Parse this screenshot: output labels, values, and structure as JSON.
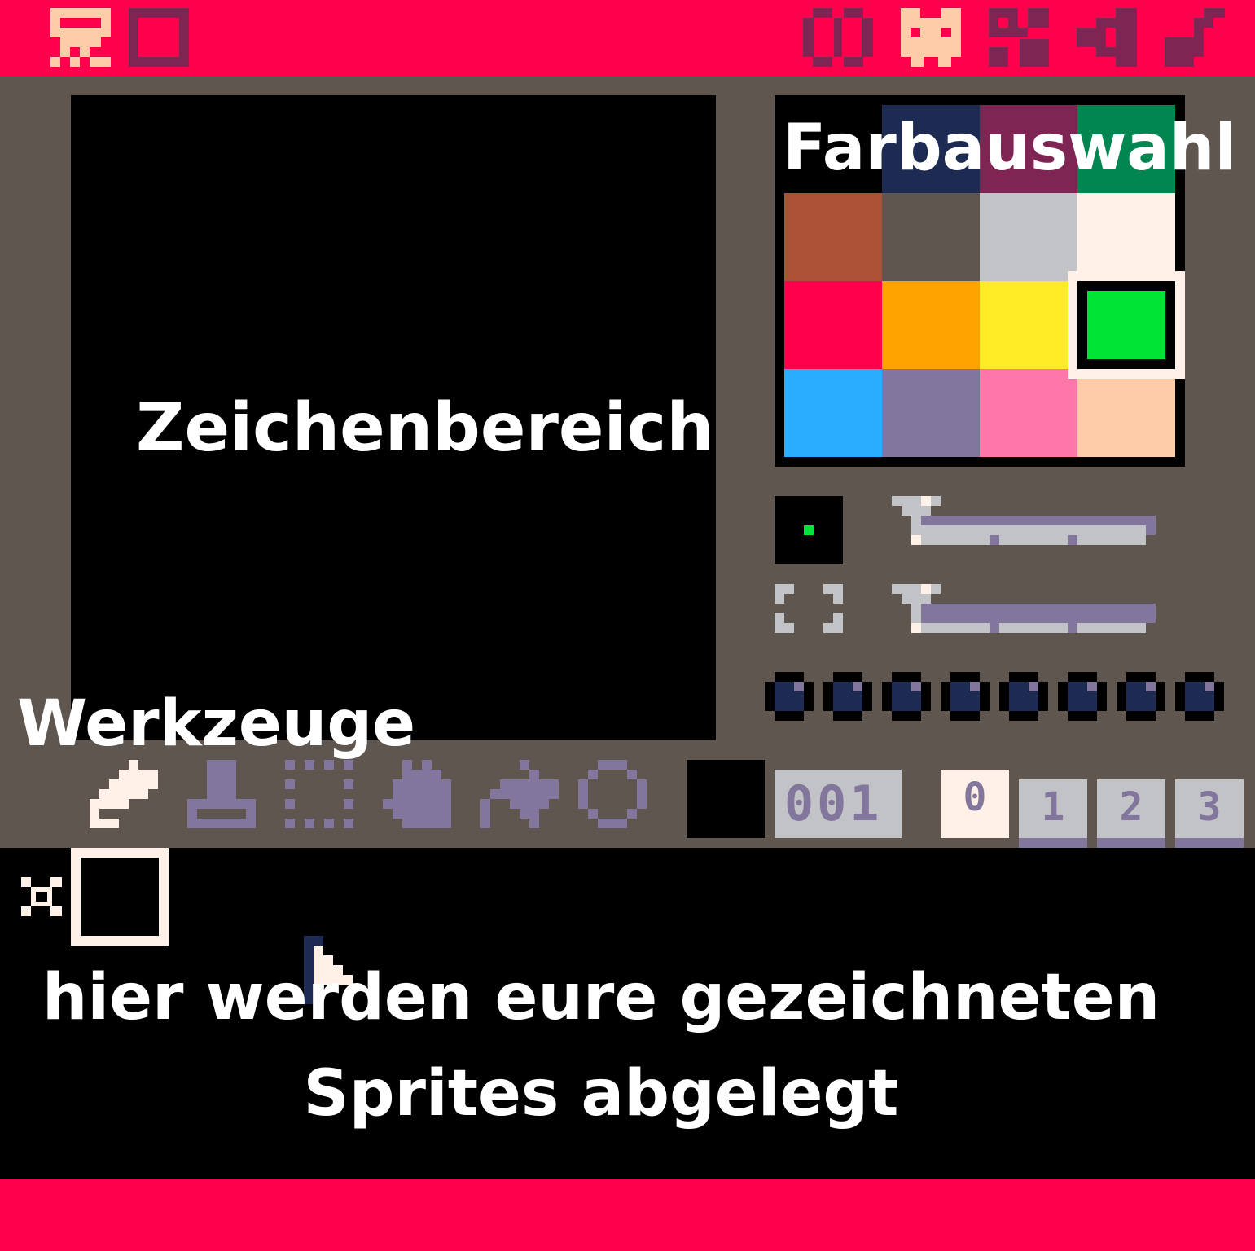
{
  "colors": {
    "topbar": "#ff004d",
    "editor_bg": "#5f574f",
    "canvas_bg": "#000000",
    "icon_inactive": "#7e2553",
    "icon_active": "#ffccaa",
    "light": "#fff1e8",
    "lavender": "#83769c",
    "light_grey": "#c2c3c7",
    "dark_blue": "#1d2b53"
  },
  "topbar": {
    "mode_icons": [
      "code-editor-icon",
      "sprite-editor-icon",
      "map-editor-icon",
      "sfx-editor-icon",
      "music-editor-icon"
    ],
    "active_mode": "sprite-editor-icon"
  },
  "palette": {
    "colors": [
      "#000000",
      "#1d2b53",
      "#7e2553",
      "#008751",
      "#ab5236",
      "#5f574f",
      "#c2c3c7",
      "#fff1e8",
      "#ff004d",
      "#ffa300",
      "#ffec27",
      "#00e436",
      "#29adff",
      "#83769c",
      "#ff77a8",
      "#ffccaa"
    ],
    "selected_index": 11
  },
  "brush": {
    "size_level": 0.0,
    "zoom_level": 0.0
  },
  "tools": [
    "pencil-icon",
    "stamp-icon",
    "select-icon",
    "pan-icon",
    "fill-icon",
    "shape-icon"
  ],
  "sprite_number": "001",
  "sheet_tabs": [
    "0",
    "1",
    "2",
    "3"
  ],
  "active_tab": "0",
  "annotations": {
    "palette_label": "Farbauswahl",
    "canvas_label": "Zeichenbereich",
    "tools_label": "Werkzeuge",
    "sheet_label_line1": "hier werden eure gezeichneten",
    "sheet_label_line2": "Sprites abgelegt"
  }
}
